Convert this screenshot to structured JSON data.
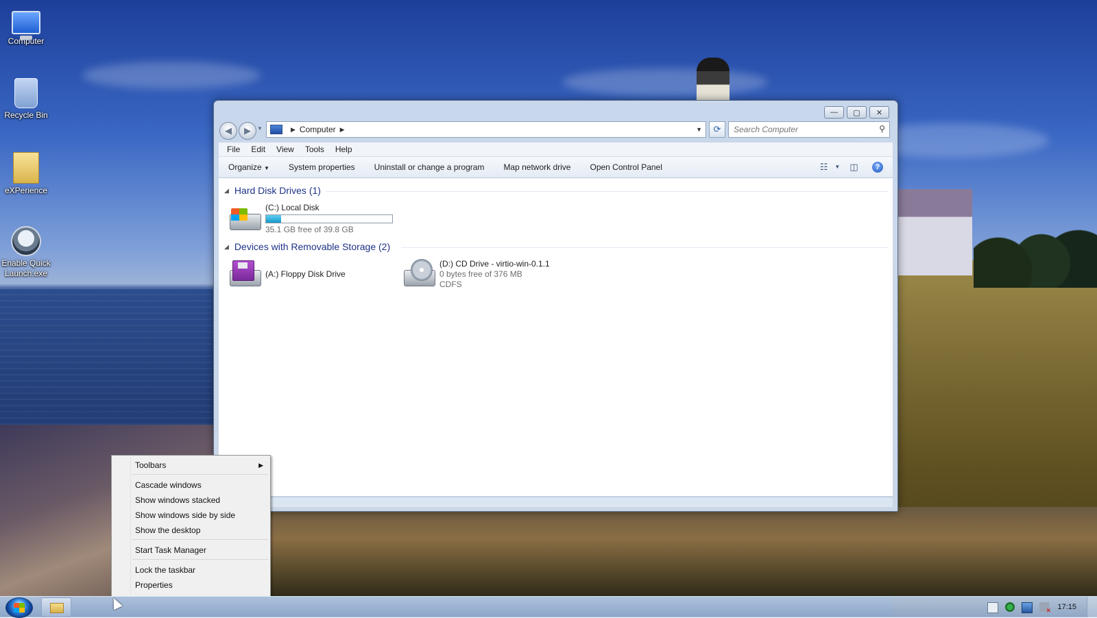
{
  "desktop": {
    "icons": [
      {
        "label": "Computer",
        "icon": "computer-icon"
      },
      {
        "label": "Recycle Bin",
        "icon": "recycle-bin-icon"
      },
      {
        "label": "eXPerience",
        "icon": "folder-icon"
      },
      {
        "label": "Enable Quick Launch.exe",
        "icon": "application-icon"
      }
    ]
  },
  "explorer": {
    "address": {
      "segment": "Computer"
    },
    "search": {
      "placeholder": "Search Computer"
    },
    "window_controls": {
      "minimize": "—",
      "maximize": "▢",
      "close": "✕"
    },
    "menu": [
      "File",
      "Edit",
      "View",
      "Tools",
      "Help"
    ],
    "toolbar": {
      "organize": "Organize",
      "system_properties": "System properties",
      "uninstall": "Uninstall or change a program",
      "map_drive": "Map network drive",
      "control_panel": "Open Control Panel"
    },
    "groups": {
      "hard_disks": {
        "title": "Hard Disk Drives (1)",
        "drives": [
          {
            "name": "(C:) Local Disk",
            "free": "35.1 GB free of 39.8 GB",
            "used_fraction": 0.12
          }
        ]
      },
      "removable": {
        "title": "Devices with Removable Storage (2)",
        "drives": [
          {
            "name": "(A:) Floppy Disk Drive"
          },
          {
            "name": "(D:) CD Drive - virtio-win-0.1.1",
            "free": "0 bytes free of 376 MB",
            "fs": "CDFS"
          }
        ]
      }
    }
  },
  "context_menu": {
    "items": [
      {
        "label": "Toolbars",
        "submenu": true
      },
      {
        "label": "Cascade windows"
      },
      {
        "label": "Show windows stacked"
      },
      {
        "label": "Show windows side by side"
      },
      {
        "label": "Show the desktop"
      },
      {
        "label": "Start Task Manager"
      },
      {
        "label": "Lock the taskbar"
      },
      {
        "label": "Properties"
      }
    ]
  },
  "taskbar": {
    "clock": "17:15"
  },
  "colors": {
    "accent_text": "#1e3287",
    "capacity_fill": "#1798c8"
  }
}
